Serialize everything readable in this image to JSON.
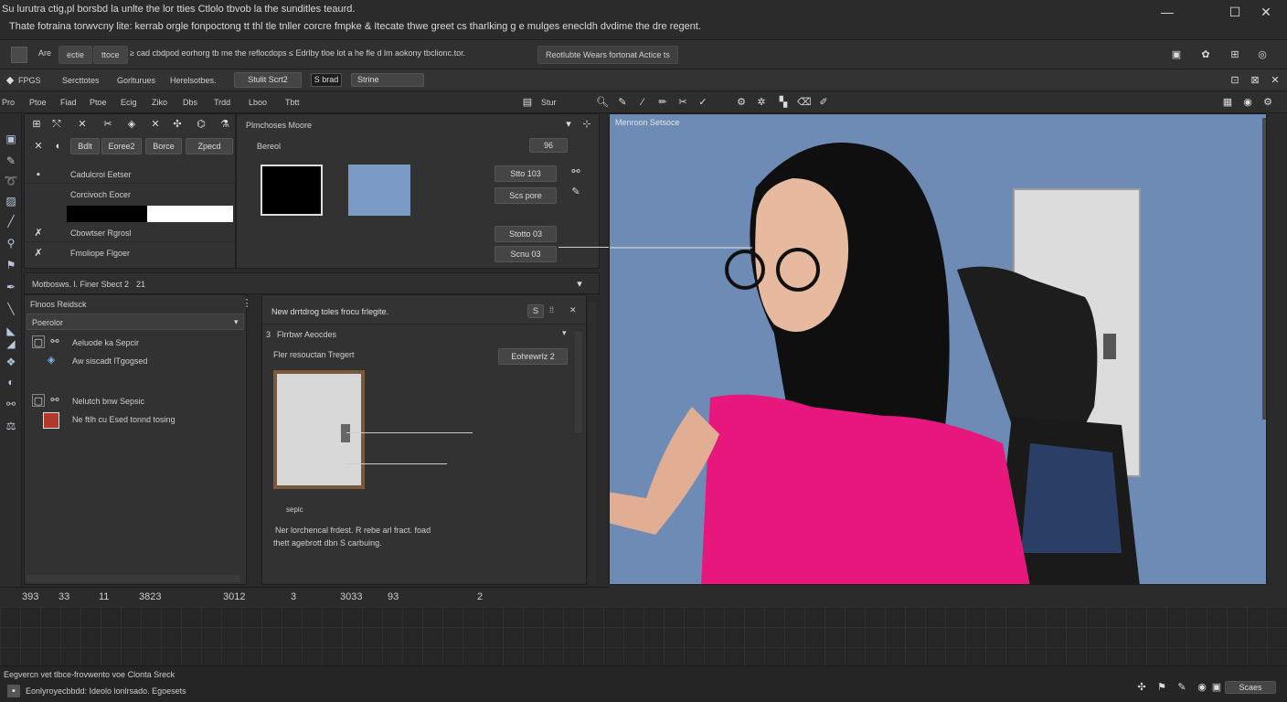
{
  "window": {
    "title_line1": "Su lurutra ctig,pl borsbd la unlte the lor tties Ctlolo tbvob la the sunditles teaurd.",
    "title_line2": "Thate fotraina torwvcny lite: kerrab orgle fonpoctong tt thl tle tnller corcre fmpke & Itecate thwe greet cs tharlking g e mulges enecldh dvdime the dre regent.",
    "minimize": "—",
    "maximize": "☐",
    "close": "✕"
  },
  "menubar": {
    "btn_left1": "Are",
    "btn_left2": "ectie",
    "btn_left3": "ttoce",
    "text": "≥ cad cbdpod eorhorg tb me the reflocdops  ≤  Edrlby tloe lot a he fle d lm aokony tbclionc.tor.",
    "right_box": "Reotlubte  Wears fortonat Actice ts"
  },
  "row2": {
    "items": [
      "FPGS",
      "Sercttotes",
      "Gorlturues",
      "Herelsotbes."
    ],
    "box1": "Stulit Scrt2",
    "box2": "S brad",
    "select": "Strine"
  },
  "row3": {
    "items": [
      "Pro",
      "Ptoe",
      "Fiad",
      "Ptoe",
      "Ecig",
      "Ziko",
      "Dbs",
      "Trdd",
      "Lboo",
      "Tbtt"
    ],
    "search": "Stur"
  },
  "layers_panel": {
    "tabs": [
      "Bdlt",
      "Eoree2",
      "Borce",
      "Zpecd"
    ],
    "rows": [
      "Cadulcroi Eetser",
      "Corcivoch Eocer",
      "Cbowtser Rgrosl",
      "Fmoliope Flgoer"
    ]
  },
  "swatch_panel": {
    "header": "Plmchoses Moore",
    "sub": "Bereol",
    "control": "96",
    "buttons": [
      "Stto 103",
      "Scs pore",
      "Stotto 03",
      "Scnu 03"
    ]
  },
  "prop_panel": {
    "tab": "Motbosws. l. Finer Sbect 2",
    "tab_num": "21",
    "sub": "Flnoos Reidsck",
    "dropdown": "Poerolor",
    "items": [
      "Aeluode ka Sepcir",
      "Aw siscadt lTgogsed",
      "Nelutch bnw Sepsic",
      "Ne ftlh cu Esed tonnd tosing"
    ]
  },
  "frame_panel": {
    "header": "New drrtdrog toles frocu frlegite.",
    "header_num": "S",
    "sub": "Flrrbwr Aeocdes",
    "sub_num": "3",
    "label": "Fler resouctan Tregert",
    "btn": "Eohrewrlz 2",
    "caption": "sepic",
    "desc1": "Ner lorchencal frdest. R rebe arl fract. foad",
    "desc2": "thett agebrott dbn S carbuing."
  },
  "viewport": {
    "title": "Menroon Setsoce"
  },
  "timeline": {
    "marks": [
      "393",
      "33",
      "11",
      "3823",
      "3012",
      "3",
      "3033",
      "93",
      "2"
    ]
  },
  "statusbar": {
    "line1": "Eegvercn vet tlbce-frovwento voe Clonta Sreck",
    "line2": "Eonlyroyecbbdd: Ideolo lonlrsado. Egoesets",
    "right": "Scaes"
  },
  "colors": {
    "accent": "#6e8bb5",
    "shirt": "#e8177e"
  }
}
